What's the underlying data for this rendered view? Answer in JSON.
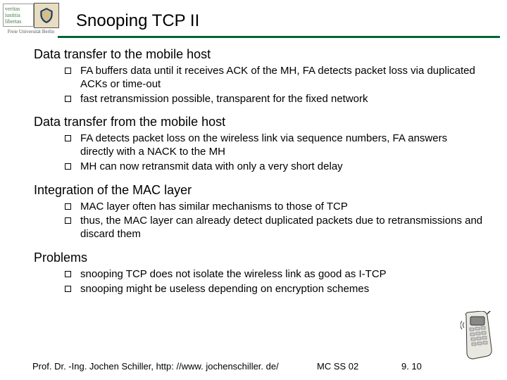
{
  "header": {
    "motto_line1": "veritas",
    "motto_line2": "iustitia",
    "motto_line3": "libertas",
    "university": "Freie Universität Berlin",
    "title": "Snooping TCP II"
  },
  "sections": [
    {
      "title": "Data transfer to the mobile host",
      "items": [
        "FA buffers data until it receives ACK of the MH, FA detects packet loss via duplicated ACKs or time-out",
        "fast retransmission possible, transparent for the fixed network"
      ]
    },
    {
      "title": "Data transfer from the mobile host",
      "items": [
        "FA detects packet loss on the wireless link via sequence numbers, FA answers directly with a NACK to the MH",
        "MH can now retransmit data with only a very short delay"
      ]
    },
    {
      "title": "Integration of the MAC layer",
      "items": [
        "MAC layer often has similar mechanisms to those of TCP",
        "thus, the MAC layer can already detect duplicated packets due to retransmissions and discard them"
      ]
    },
    {
      "title": "Problems",
      "items": [
        "snooping TCP does not isolate the wireless link as good as I-TCP",
        "snooping might be useless depending on encryption schemes"
      ]
    }
  ],
  "footer": {
    "author": "Prof. Dr. -Ing. Jochen Schiller, http: //www. jochenschiller. de/",
    "course": "MC SS 02",
    "page": "9. 10"
  }
}
